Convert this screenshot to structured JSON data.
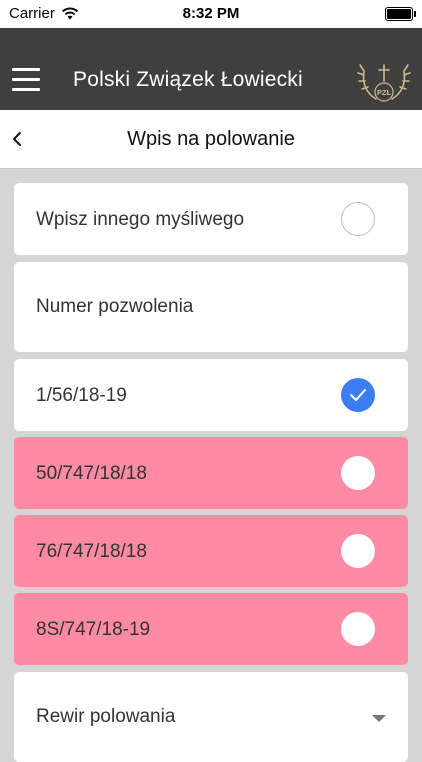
{
  "status_bar": {
    "carrier": "Carrier",
    "time": "8:32 PM"
  },
  "header": {
    "title": "Polski Związek Łowiecki",
    "logo_text": "PZŁ"
  },
  "nav": {
    "title": "Wpis na polowanie"
  },
  "form": {
    "other_hunter_label": "Wpisz innego myśliwego",
    "permit_number_placeholder": "Numer pozwolenia",
    "permits": [
      {
        "number": "1/56/18-19",
        "selected": true
      },
      {
        "number": "50/747/18/18",
        "selected": false
      },
      {
        "number": "76/747/18/18",
        "selected": false
      },
      {
        "number": "8S/747/18-19",
        "selected": false
      }
    ],
    "district_placeholder": "Rewir polowania"
  },
  "colors": {
    "header_bg": "#3f3f3f",
    "highlight_pink": "#ff8aa3",
    "check_blue": "#3b7df2"
  }
}
